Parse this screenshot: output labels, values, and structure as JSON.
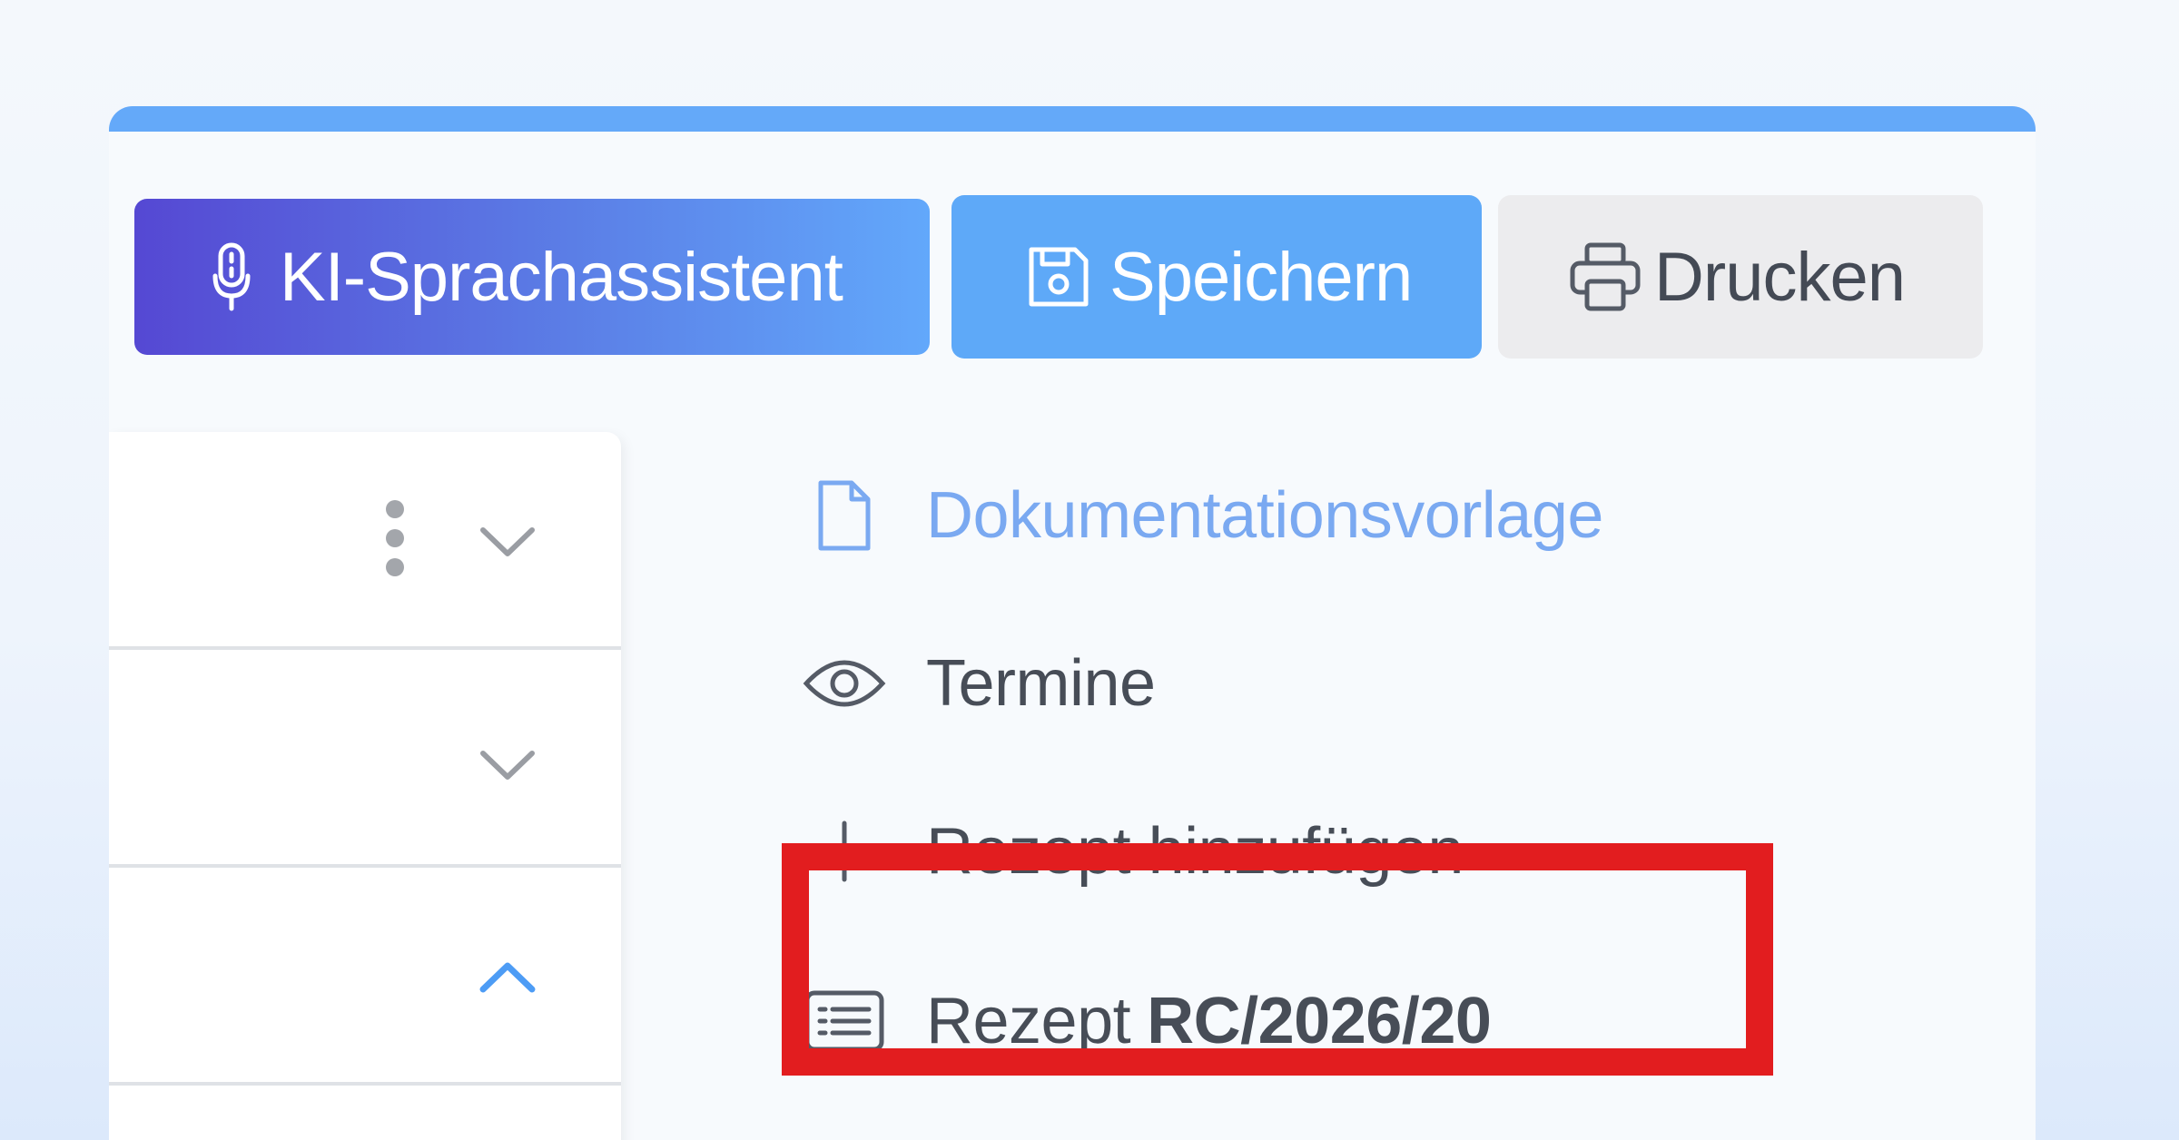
{
  "toolbar": {
    "ai_assistant_label": "KI-Sprachassistent",
    "save_label": "Speichern",
    "print_label": "Drucken"
  },
  "actions": [
    {
      "label": "Dokumentationsvorlage",
      "icon": "document-icon"
    },
    {
      "label": "Termine",
      "icon": "eye-icon"
    },
    {
      "label": "Rezept hinzufügen",
      "icon": "plus-icon"
    },
    {
      "label": "Rezept",
      "value": "RC/2026/20",
      "icon": "list-icon"
    }
  ],
  "accordion": {
    "rows": [
      {
        "state": "collapsed",
        "has_menu": true
      },
      {
        "state": "collapsed"
      },
      {
        "state": "expanded"
      }
    ]
  },
  "colors": {
    "accent": "#5ea9f8",
    "ai_gradient_start": "#5548d3",
    "ai_gradient_end": "#62a8fb",
    "highlight": "#e21d1f",
    "link": "#7aa9f1",
    "text": "#474d57"
  }
}
